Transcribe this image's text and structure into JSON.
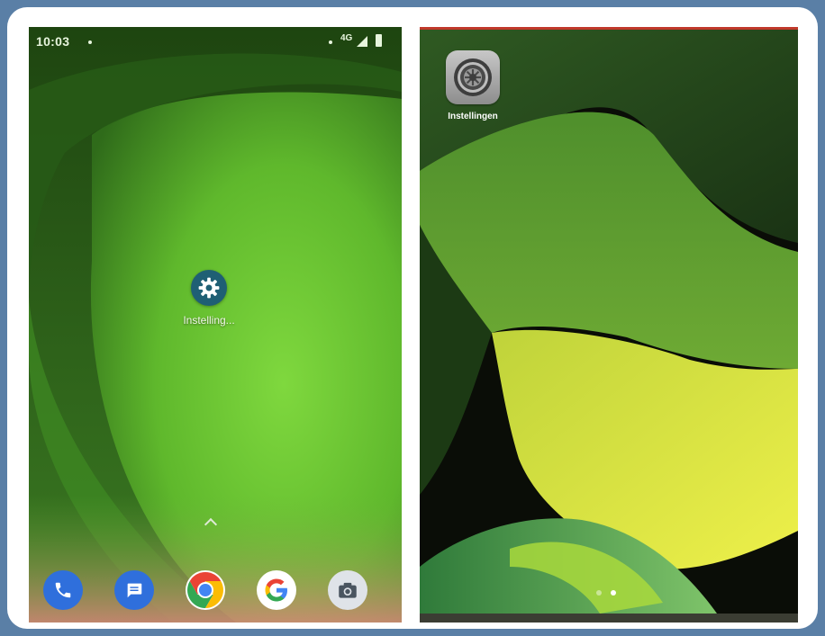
{
  "android": {
    "status_bar": {
      "time": "10:03",
      "network": "4G",
      "icons": [
        "notification-dot-icon",
        "signal-icon",
        "battery-icon"
      ]
    },
    "home_app": {
      "label": "Instelling...",
      "icon": "gear-icon"
    },
    "dock": [
      {
        "name": "phone",
        "icon": "phone-icon",
        "color": "#2f6fdc"
      },
      {
        "name": "messages",
        "icon": "message-icon",
        "color": "#2f6fdc"
      },
      {
        "name": "chrome",
        "icon": "chrome-icon",
        "color": "#ea4335"
      },
      {
        "name": "google",
        "icon": "google-icon",
        "color": "#ffffff"
      },
      {
        "name": "camera",
        "icon": "camera-icon",
        "color": "#dfe3e8"
      }
    ]
  },
  "ios": {
    "home_app": {
      "label": "Instellingen",
      "icon": "gear-icon"
    },
    "page_dots": {
      "count": 2,
      "active_index": 1
    }
  },
  "colors": {
    "frame_background": "#5a7fa6",
    "card": "#ffffff",
    "android_wallpaper_primary": "#6ac43a",
    "ios_wallpaper_accent": "#e0e84a"
  }
}
